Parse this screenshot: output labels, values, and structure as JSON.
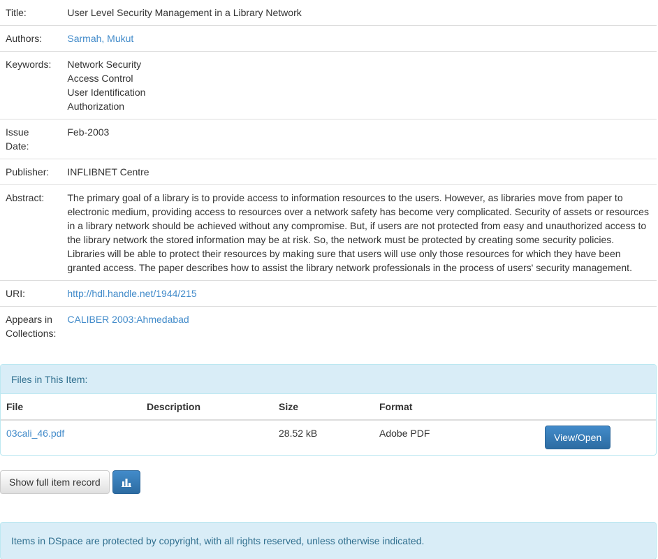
{
  "metadata": {
    "title_label": "Title:",
    "title_value": "User Level Security Management in a Library Network",
    "authors_label": "Authors:",
    "authors_value": "Sarmah, Mukut",
    "keywords_label": "Keywords:",
    "keywords": [
      "Network Security",
      "Access Control",
      "User Identification",
      "Authorization"
    ],
    "issue_label_1": "Issue",
    "issue_label_2": "Date:",
    "issue_value": "Feb-2003",
    "publisher_label": "Publisher:",
    "publisher_value": "INFLIBNET Centre",
    "abstract_label": "Abstract:",
    "abstract_value": "The primary goal of a library is to provide access to information resources to the users. However, as libraries move from paper to electronic medium, providing access to resources over a network safety has become very complicated. Security of assets or resources in a library network should be achieved without any compromise. But, if users are not protected from easy and unauthorized access to the library network the stored information may be at risk. So, the network must be protected by creating some security policies. Libraries will be able to protect their resources by making sure that users will use only those resources for which they have been granted access. The paper describes how to assist the library network professionals in the process of users' security management.",
    "uri_label": "URI:",
    "uri_value": "http://hdl.handle.net/1944/215",
    "collections_label_1": "Appears in",
    "collections_label_2": "Collections:",
    "collections_value": "CALIBER 2003:Ahmedabad"
  },
  "files": {
    "heading": "Files in This Item:",
    "columns": [
      "File",
      "Description",
      "Size",
      "Format"
    ],
    "rows": [
      {
        "file": "03cali_46.pdf",
        "description": "",
        "size": "28.52 kB",
        "format": "Adobe PDF",
        "action": "View/Open"
      }
    ]
  },
  "actions": {
    "full_record_label": "Show full item record",
    "stats_icon": "bar-chart-icon"
  },
  "footer": {
    "notice": "Items in DSpace are protected by copyright, with all rights reserved, unless otherwise indicated."
  },
  "colors": {
    "link": "#428bca",
    "panel_bg": "#d9edf7",
    "panel_text": "#31708f",
    "primary_button": "#3071a9"
  }
}
